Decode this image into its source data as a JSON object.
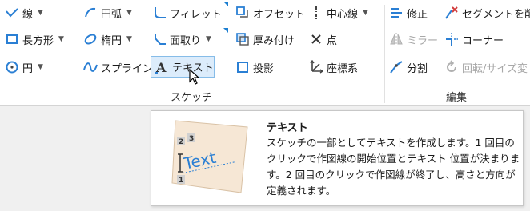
{
  "ribbon": {
    "row1": {
      "line": "線",
      "arc": "円弧",
      "fillet": "フィレット",
      "offset": "オフセット",
      "centerline": "中心線",
      "modify": "修正",
      "delete_segment": "セグメントを削"
    },
    "row2": {
      "rectangle": "長方形",
      "ellipse": "楕円",
      "chamfer": "面取り",
      "thicken": "厚み付け",
      "point": "点",
      "mirror": "ミラー",
      "corner": "コーナー"
    },
    "row3": {
      "circle": "円",
      "spline": "スプライン",
      "text": "テキスト",
      "project": "投影",
      "coordinate_system": "座標系",
      "divide": "分割",
      "rotate_resize": "回転/サイズ変"
    },
    "groups": {
      "sketch": "スケッチ",
      "edit": "編集"
    }
  },
  "tooltip": {
    "title": "テキスト",
    "description": "スケッチの一部としてテキストを作成します。1 回目のクリックで作図線の開始位置とテキスト 位置が決まります。2 回目のクリックで作図線が終了し、高さと方向が定義されます。",
    "illustration": {
      "sample_text": "Text",
      "step1": "1",
      "step2": "2",
      "step3": "3"
    }
  },
  "colors": {
    "accent": "#1c7fd1",
    "icon_blue": "#2a7fd4",
    "highlight_bg": "#dcecfb",
    "highlight_border": "#86bce8",
    "disabled": "#a8a8a8"
  }
}
